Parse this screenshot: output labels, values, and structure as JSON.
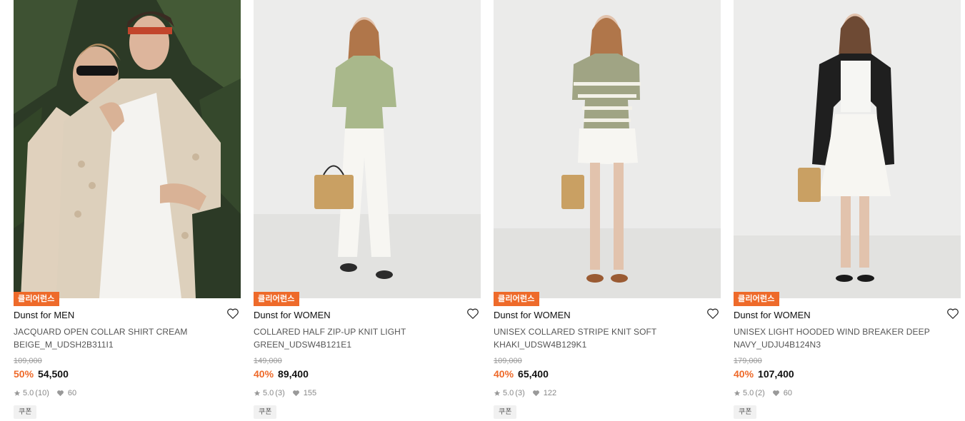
{
  "products": [
    {
      "tag": "클리어런스",
      "brand": "Dunst for MEN",
      "name": "JACQUARD OPEN COLLAR SHIRT CREAM BEIGE_M_UDSH2B311I1",
      "original_price": "109,000",
      "discount": "50%",
      "price": "54,500",
      "rating": "5.0",
      "reviews": "(10)",
      "likes": "60",
      "coupon": "쿠폰"
    },
    {
      "tag": "클리어런스",
      "brand": "Dunst for WOMEN",
      "name": "COLLARED HALF ZIP-UP KNIT LIGHT GREEN_UDSW4B121E1",
      "original_price": "149,000",
      "discount": "40%",
      "price": "89,400",
      "rating": "5.0",
      "reviews": "(3)",
      "likes": "155",
      "coupon": "쿠폰"
    },
    {
      "tag": "클리어런스",
      "brand": "Dunst for WOMEN",
      "name": "UNISEX COLLARED STRIPE KNIT SOFT KHAKI_UDSW4B129K1",
      "original_price": "109,000",
      "discount": "40%",
      "price": "65,400",
      "rating": "5.0",
      "reviews": "(3)",
      "likes": "122",
      "coupon": "쿠폰"
    },
    {
      "tag": "클리어런스",
      "brand": "Dunst for WOMEN",
      "name": "UNISEX LIGHT HOODED WIND BREAKER DEEP NAVY_UDJU4B124N3",
      "original_price": "179,000",
      "discount": "40%",
      "price": "107,400",
      "rating": "5.0",
      "reviews": "(2)",
      "likes": "60",
      "coupon": "쿠폰"
    }
  ],
  "colors": {
    "accent": "#ee6a2a",
    "text": "#111111",
    "muted": "#888888"
  },
  "icons": [
    "heart-outline-icon",
    "star-icon",
    "heart-filled-icon"
  ]
}
